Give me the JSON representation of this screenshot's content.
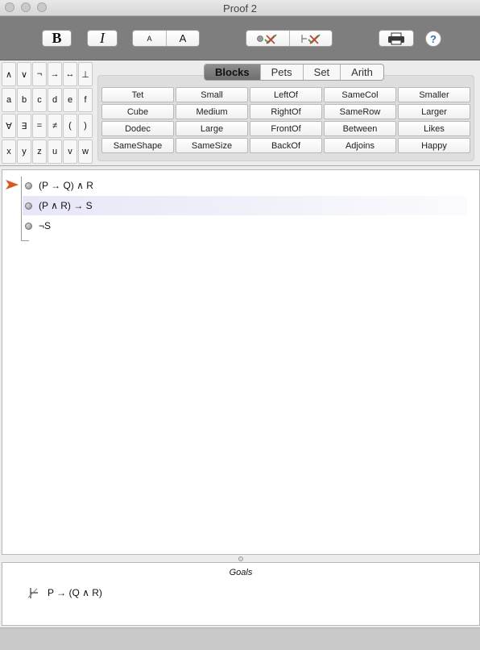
{
  "window": {
    "title": "Proof 2"
  },
  "toolbar": {
    "bold_label": "B",
    "italic_label": "I",
    "font_small_label": "A",
    "font_large_label": "A",
    "print_icon": "printer-icon",
    "help_label": "?"
  },
  "symbols": [
    [
      "∧",
      "∨",
      "¬",
      "→",
      "↔",
      "⊥"
    ],
    [
      "a",
      "b",
      "c",
      "d",
      "e",
      "f"
    ],
    [
      "∀",
      "∃",
      "=",
      "≠",
      "(",
      ")"
    ],
    [
      "x",
      "y",
      "z",
      "u",
      "v",
      "w"
    ]
  ],
  "tabs": [
    {
      "label": "Blocks",
      "active": true
    },
    {
      "label": "Pets",
      "active": false
    },
    {
      "label": "Set",
      "active": false
    },
    {
      "label": "Arith",
      "active": false
    }
  ],
  "predicates": [
    [
      "Tet",
      "Small",
      "LeftOf",
      "SameCol",
      "Smaller"
    ],
    [
      "Cube",
      "Medium",
      "RightOf",
      "SameRow",
      "Larger"
    ],
    [
      "Dodec",
      "Large",
      "FrontOf",
      "Between",
      "Likes"
    ],
    [
      "SameShape",
      "SameSize",
      "BackOf",
      "Adjoins",
      "Happy"
    ]
  ],
  "proof": {
    "steps": [
      {
        "formula": "(P → Q) ∧ R",
        "selected": false,
        "current": true
      },
      {
        "formula": "(P ∧ R) → S",
        "selected": true,
        "current": false
      },
      {
        "formula": "¬S",
        "selected": false,
        "current": false
      }
    ]
  },
  "goals": {
    "title": "Goals",
    "items": [
      {
        "formula": "P → (Q ∧ R)"
      }
    ]
  },
  "colors": {
    "toolbar_bg": "#7e7e7e",
    "arrow": "#e2561d",
    "check": "#2faa2f",
    "cross": "#d23b3b"
  }
}
